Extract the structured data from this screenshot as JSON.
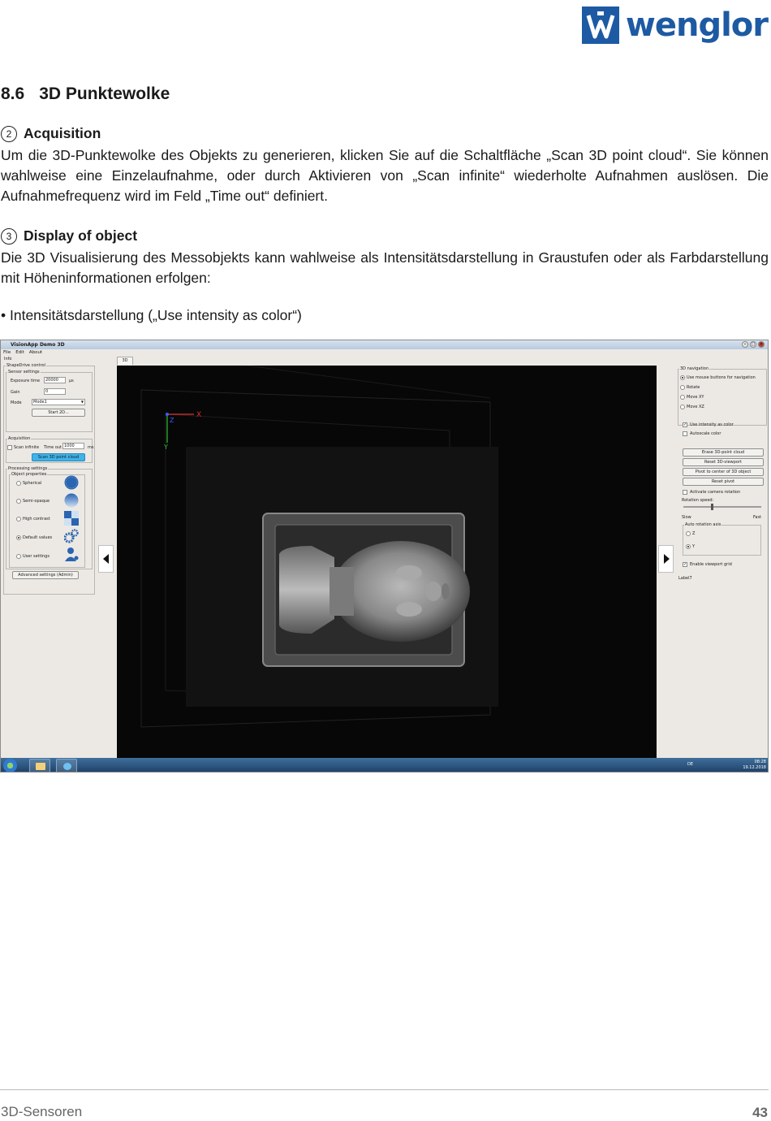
{
  "logo": {
    "text": "wenglor",
    "icon": "wenglor-logo-icon"
  },
  "heading": {
    "number": "8.6",
    "title": "3D Punktewolke"
  },
  "sections": [
    {
      "marker": "2",
      "title": "Acquisition",
      "text": "Um die 3D-Punktewolke des Objekts zu generieren, klicken Sie auf die Schaltfläche „Scan 3D point cloud“. Sie können wahlweise eine Einzelaufnahme, oder durch Aktivieren von „Scan infinite“ wiederholte Aufnahmen auslösen. Die Aufnahmefrequenz wird im Feld „Time out“ definiert."
    },
    {
      "marker": "3",
      "title": "Display of object",
      "text": "Die 3D Visualisierung des Messobjekts kann wahlweise als Intensitätsdarstellung in Graustufen oder als Farbdarstellung mit Höheninformationen erfolgen:"
    }
  ],
  "bullet": "• Intensitätsdarstellung („Use intensity as color“)",
  "app": {
    "title": "VisionApp Demo 3D",
    "menu": [
      "File",
      "Edit",
      "About"
    ],
    "left": {
      "tab": "Info",
      "shapedrive_group": "ShapeDrive control",
      "sensor_group": "Sensor settings",
      "exposure_label": "Exposure time",
      "exposure_value": "20000",
      "exposure_unit": "µs",
      "gain_label": "Gain",
      "gain_value": "0",
      "mode_label": "Mode",
      "mode_value": "Mode1",
      "start_button": "Start 2D...",
      "acq_group": "Acquisition",
      "scan_infinite": "Scan infinite",
      "timeout_label": "Time out",
      "timeout_value": "1000",
      "timeout_unit": "ms",
      "scan_button": "Scan 3D point cloud",
      "proc_group": "Processing settings",
      "object_group": "Object properties",
      "options": [
        "Spherical",
        "Semi-opaque",
        "High contrast",
        "Default values",
        "User settings"
      ],
      "advanced_button": "Advanced settings (Admin)"
    },
    "view_tab": "3D",
    "axes": {
      "x": "X",
      "y": "Y",
      "z": "Z"
    },
    "right": {
      "nav_group": "3D navigation",
      "nav_options": [
        "Use mouse buttons for navigation",
        "Rotate",
        "Move XY",
        "Move XZ"
      ],
      "use_intensity": "Use intensity as color",
      "autoscale": "Autoscale color",
      "buttons": [
        "Erase 3D-point cloud",
        "Reset 3D-viewport",
        "Pivot to center of 3D object",
        "Reset pivot"
      ],
      "activate_rotation": "Activate camera rotation",
      "rotation_speed": "Rotation speed:",
      "slow": "Slow",
      "fast": "Fast",
      "axis_group": "Auto rotation axis",
      "axis_options": [
        "Z",
        "Y"
      ],
      "enable_grid": "Enable viewport grid",
      "label7": "Label7"
    },
    "taskbar": {
      "lang": "DE",
      "time": "08:28",
      "date": "19.12.2018"
    }
  },
  "footer": {
    "left": "3D-Sensoren",
    "page": "43"
  },
  "colors": {
    "brand": "#1d5aa3",
    "scan_button": "#3fb3ea"
  }
}
